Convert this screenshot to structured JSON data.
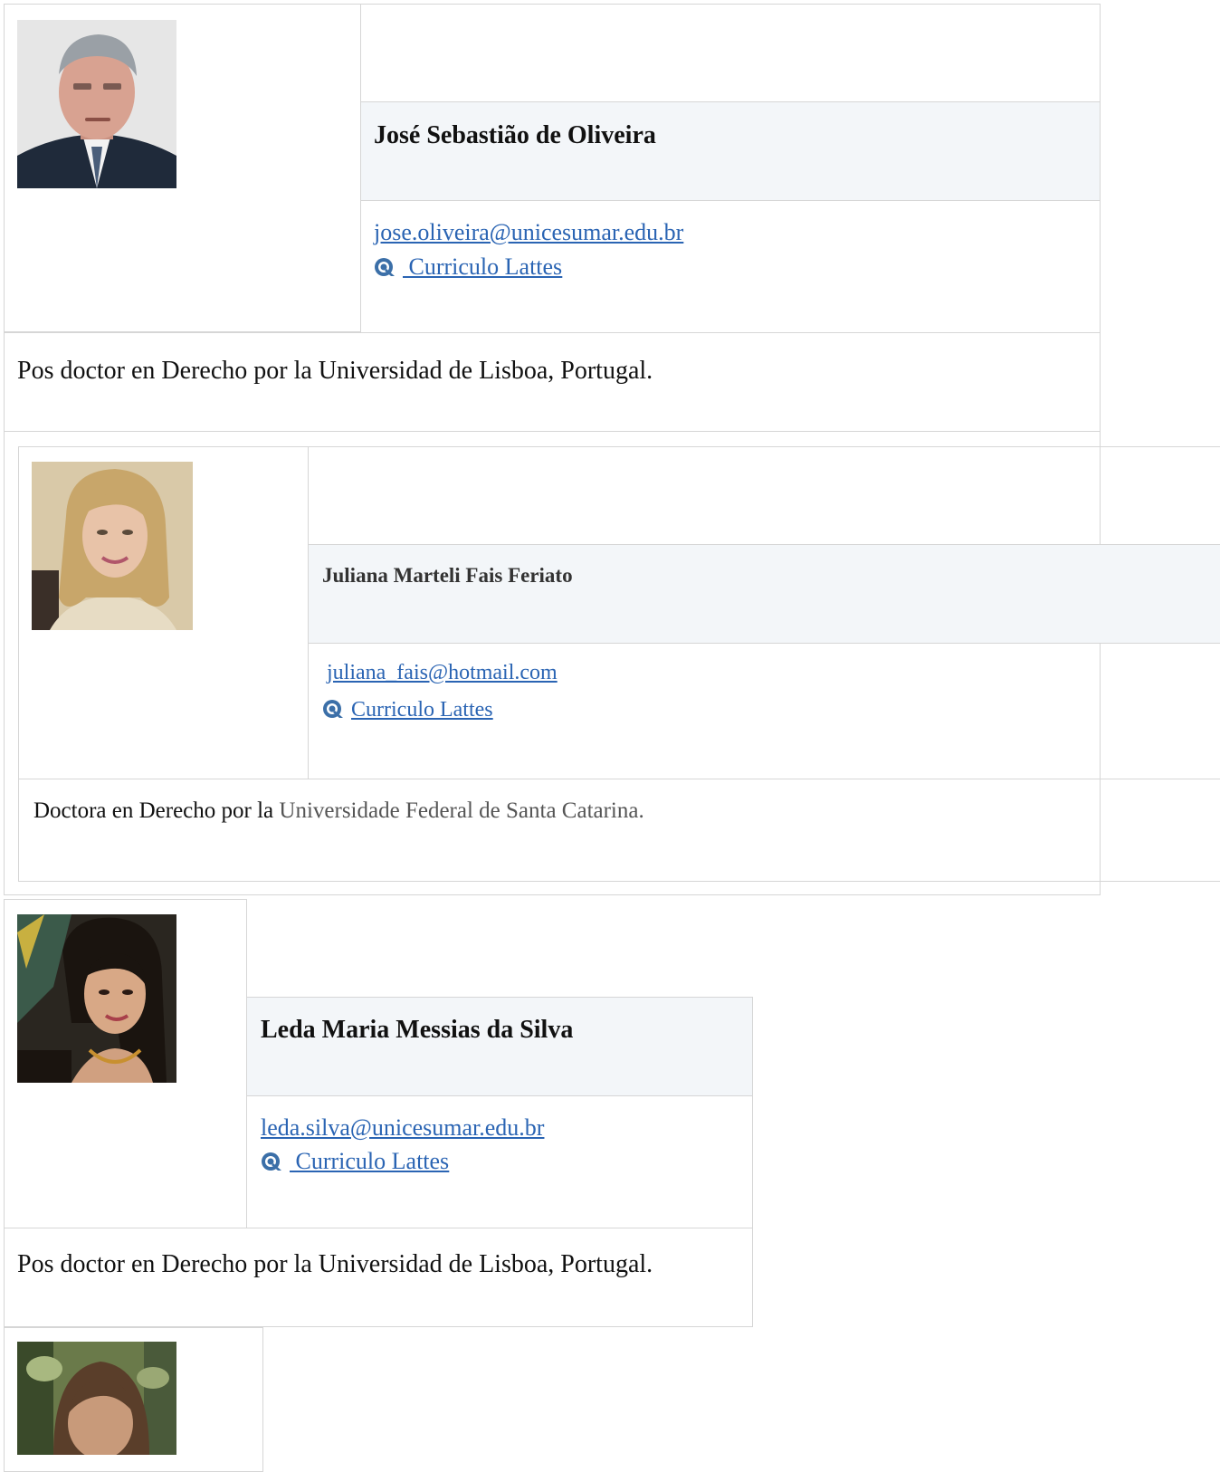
{
  "people": [
    {
      "name": "José Sebastião de Oliveira",
      "email": " jose.oliveira@unicesumar.edu.br ",
      "cv_label": " Curriculo Lattes",
      "description": "Pos doctor en Derecho por la Universidad de Lisboa, Portugal.",
      "photo_icon": "portrait-man-grey-hair"
    },
    {
      "name": "Juliana Marteli Fais Feriato",
      "email": "juliana_fais@hotmail.com",
      "cv_label": "Curriculo Lattes",
      "description_prefix": "Doctora en Derecho por la ",
      "description_suffix": "Universidade Federal de Santa Catarina.",
      "photo_icon": "portrait-woman-blonde"
    },
    {
      "name": "Leda Maria Messias da Silva",
      "email": " leda.silva@unicesumar.edu.br ",
      "cv_label": " Curriculo Lattes",
      "description": "Pos doctor en Derecho por la Universidad de Lisboa, Portugal.",
      "photo_icon": "portrait-woman-dark-hair"
    },
    {
      "photo_icon": "portrait-partial"
    }
  ],
  "icons": {
    "lattes": "lattes-logo-icon"
  },
  "colors": {
    "link": "#2a64b3",
    "header_bg": "#f3f6f9",
    "border": "#d6d6d6"
  }
}
